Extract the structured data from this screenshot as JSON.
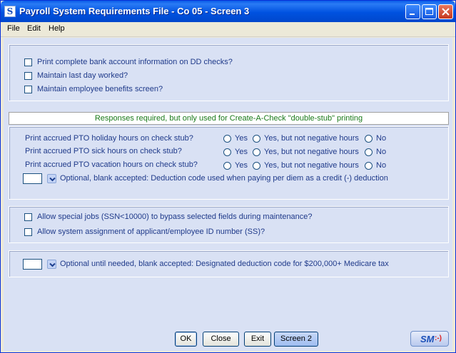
{
  "window": {
    "title": "Payroll System Requirements File - Co 05 - Screen 3",
    "icon_letter": "S"
  },
  "menu": [
    "File",
    "Edit",
    "Help"
  ],
  "section1": {
    "checks": [
      "Print complete bank account information on DD checks?",
      "Maintain last day worked?",
      "Maintain employee benefits screen?"
    ]
  },
  "banner": "Responses required, but only used for Create-A-Check \"double-stub\" printing",
  "section2": {
    "questions": [
      "Print accrued PTO holiday hours on check stub?",
      "Print accrued PTO sick hours on check stub?",
      "Print accrued PTO vacation hours on check stub?"
    ],
    "options": [
      "Yes",
      "Yes, but not negative hours",
      "No"
    ],
    "deduction_label": "Optional, blank accepted: Deduction code used when paying per diem as a credit (-) deduction"
  },
  "section3": {
    "checks": [
      "Allow special jobs (SSN<10000) to bypass selected fields during maintenance?",
      "Allow system assignment of applicant/employee ID number (SS)?"
    ]
  },
  "section4": {
    "deduction_label": "Optional until needed, blank accepted: Designated deduction code for $200,000+ Medicare tax"
  },
  "buttons": {
    "ok": "OK",
    "close": "Close",
    "exit": "Exit",
    "screen2": "Screen 2"
  },
  "logo": {
    "text": "SM",
    "smile": ":-)"
  },
  "colors": {
    "title_bar": "#0052e0",
    "client_bg": "#d9e1f4",
    "label_text": "#1f3a8a",
    "banner_text": "#1a7a1a"
  }
}
